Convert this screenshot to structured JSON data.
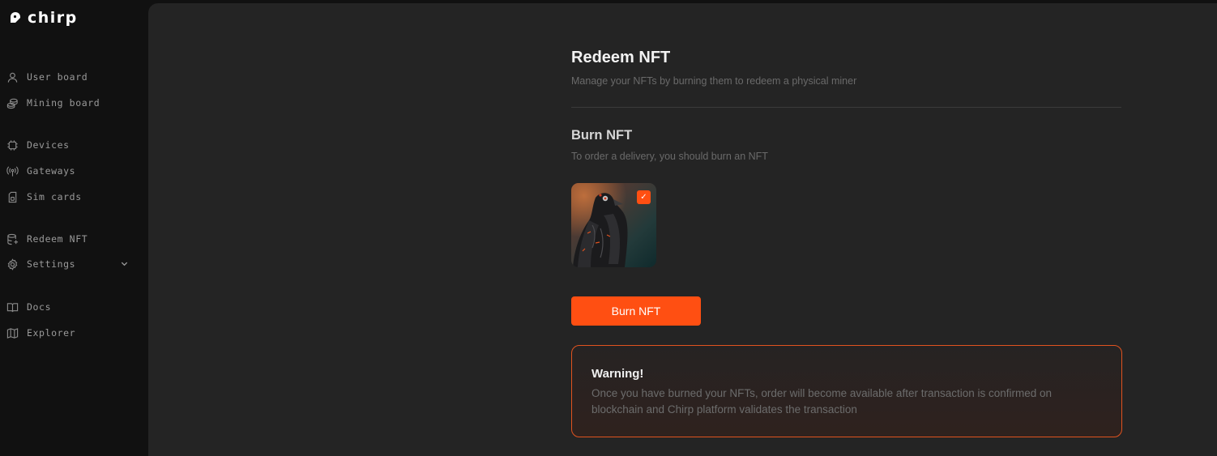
{
  "brand": {
    "name": "chirp",
    "accent": "#ff4f12"
  },
  "sidebar": {
    "items": [
      {
        "label": "User board",
        "icon": "user-icon"
      },
      {
        "label": "Mining board",
        "icon": "coins-icon"
      },
      {
        "label": "Devices",
        "icon": "chip-icon"
      },
      {
        "label": "Gateways",
        "icon": "antenna-icon"
      },
      {
        "label": "Sim cards",
        "icon": "sim-card-icon"
      },
      {
        "label": "Redeem NFT",
        "icon": "database-icon"
      },
      {
        "label": "Settings",
        "icon": "gear-icon",
        "has_submenu": true
      },
      {
        "label": "Docs",
        "icon": "book-icon"
      },
      {
        "label": "Explorer",
        "icon": "map-icon"
      }
    ]
  },
  "page": {
    "title": "Redeem NFT",
    "subtitle": "Manage your NFTs by burning them to redeem a physical miner"
  },
  "burn": {
    "title": "Burn NFT",
    "subtitle": "To order a delivery, you should burn an NFT",
    "nft": {
      "selected": true,
      "check": "✓"
    },
    "button_label": "Burn NFT"
  },
  "warning": {
    "title": "Warning!",
    "text": "Once you have burned your NFTs, order will become available after transaction is confirmed on blockchain and Chirp platform validates the transaction"
  }
}
